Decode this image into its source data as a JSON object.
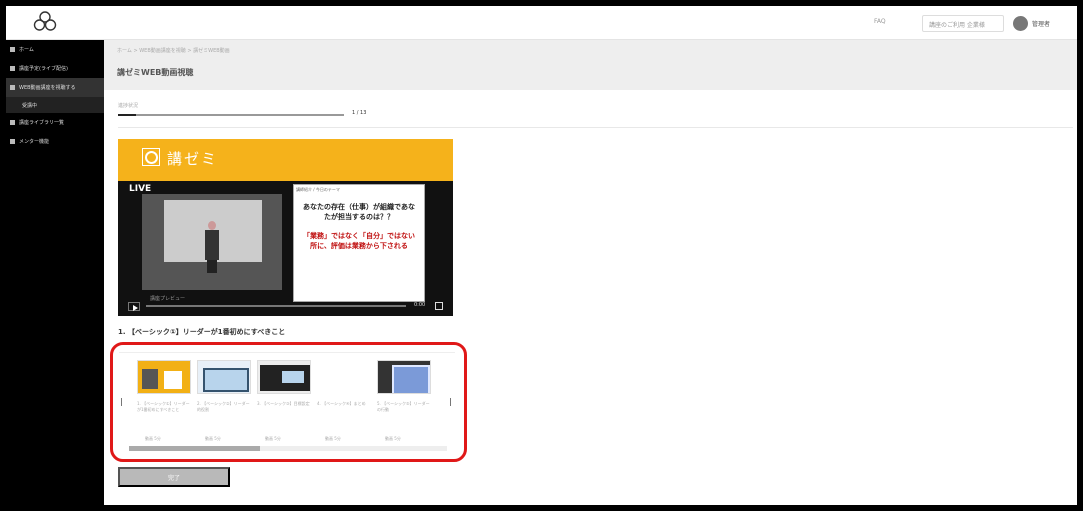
{
  "header": {
    "link": "FAQ",
    "select_value": "講座のご利用 企業様",
    "user_name": "管理者"
  },
  "sidebar": {
    "items": [
      {
        "label": "ホーム"
      },
      {
        "label": "講座予定(ライブ配信)"
      },
      {
        "label": "WEB動画講座を視聴する"
      },
      {
        "label": "受講中"
      },
      {
        "label": "講座ライブラリ一覧"
      },
      {
        "label": "メンター機能"
      }
    ]
  },
  "main": {
    "breadcrumb": "ホーム > WEB動画講座を視聴 > 講ゼミWEB動画",
    "page_title": "講ゼミWEB動画視聴",
    "progress": {
      "label": "進捗状況",
      "count": "1 / 13",
      "fraction": 0.08
    },
    "video": {
      "brand": "講ゼミ",
      "live": "LIVE",
      "slide_small": "講師紹介 / 今日のテーマ",
      "question": "あなたの存在（仕事）が組織であなたが担当するのは？？",
      "answer": "「業務」ではなく「自分」ではない所に、評価は業務から下される",
      "caption": "講座プレビュー",
      "time": "0:00"
    },
    "lesson_title": "1. 【ベーシック①】リーダーが1番初めにすべきこと",
    "carousel": {
      "cards": [
        {
          "text": "1. 【ベーシック①】リーダーが1番初めにすべきこと",
          "meta": "動画 5分"
        },
        {
          "text": "2. 【ベーシック②】リーダー的役割",
          "meta": "動画 5分"
        },
        {
          "text": "3. 【ベーシック③】目標設定",
          "meta": "動画 5分"
        },
        {
          "text": "4. 【ベーシック④】まとめ",
          "meta": "動画 5分"
        },
        {
          "text": "5. 【ベーシック⑤】リーダーの行動",
          "meta": "動画 5分"
        }
      ]
    },
    "complete_button": "完了"
  }
}
